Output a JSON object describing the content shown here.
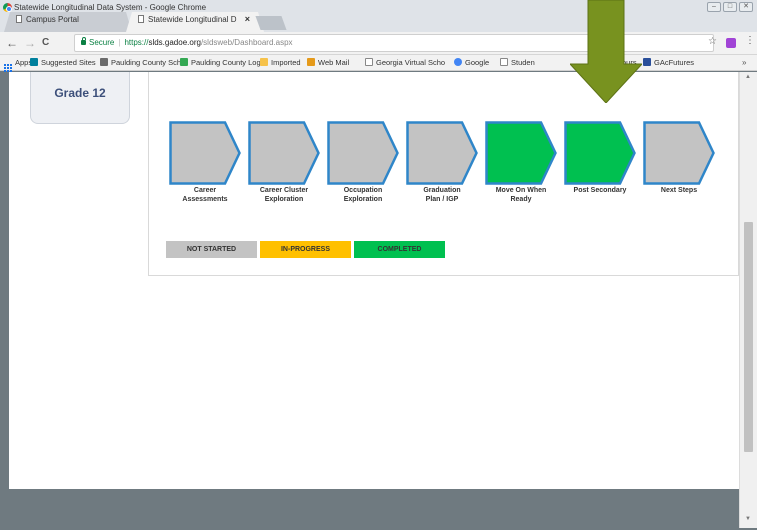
{
  "window": {
    "title": "Statewide Longitudinal Data System - Google Chrome",
    "tabs": [
      {
        "label": "Campus Portal"
      },
      {
        "label": "Statewide Longitudinal D"
      }
    ],
    "controls": [
      "–",
      "□",
      "✕"
    ]
  },
  "toolbar": {
    "back": "←",
    "forward": "→",
    "reload": "C",
    "secure_label": "Secure",
    "url_scheme": "https://",
    "url_host": "slds.gadoe.org",
    "url_path": "/sldsweb/Dashboard.aspx",
    "star": "☆",
    "menu": "⋮"
  },
  "bookmarks": [
    {
      "label": "Apps",
      "icon": "apps-grid-icon",
      "color": "#1a73e8"
    },
    {
      "label": "Suggested Sites",
      "icon": "bing-icon",
      "color": "#00809d"
    },
    {
      "label": "Paulding County Sch",
      "icon": "school-icon",
      "color": "#6b6b6b"
    },
    {
      "label": "Paulding County Log",
      "icon": "login-icon",
      "color": "#34a853"
    },
    {
      "label": "Imported",
      "icon": "folder-icon",
      "color": "#f6c24a"
    },
    {
      "label": "Web Mail",
      "icon": "mail-icon",
      "color": "#e59a1a"
    },
    {
      "label": "Georgia Virtual Scho",
      "icon": "page-icon",
      "color": "#888888"
    },
    {
      "label": "Google",
      "icon": "google-icon",
      "color": "#4285f4"
    },
    {
      "label": "Studen",
      "icon": "page-icon",
      "color": "#888888"
    },
    {
      "label": "ours",
      "icon": "",
      "color": ""
    },
    {
      "label": "GAcFutures",
      "icon": "gafutures-icon",
      "color": "#2a4f9a"
    }
  ],
  "bookmarks_more": "»",
  "page": {
    "grade_label": "Grade 12",
    "colors": {
      "not_started": "#c3c3c3",
      "in_progress": "#ffc000",
      "completed": "#00c050",
      "chevron_border": "#2f86c9"
    },
    "steps": [
      {
        "line1": "Career",
        "line2": "Assessments",
        "status": "not_started"
      },
      {
        "line1": "Career Cluster",
        "line2": "Exploration",
        "status": "not_started"
      },
      {
        "line1": "Occupation",
        "line2": "Exploration",
        "status": "not_started"
      },
      {
        "line1": "Graduation",
        "line2": "Plan / IGP",
        "status": "not_started"
      },
      {
        "line1": "Move On When",
        "line2": "Ready",
        "status": "completed"
      },
      {
        "line1": "Post Secondary",
        "line2": "",
        "status": "completed"
      },
      {
        "line1": "Next Steps",
        "line2": "",
        "status": "not_started"
      }
    ],
    "legend": [
      {
        "label": "NOT STARTED",
        "status": "not_started"
      },
      {
        "label": "IN-PROGRESS",
        "status": "in_progress"
      },
      {
        "label": "COMPLETED",
        "status": "completed"
      }
    ]
  },
  "annotation": {
    "color": "#78921f",
    "points_to": "Post Secondary"
  }
}
